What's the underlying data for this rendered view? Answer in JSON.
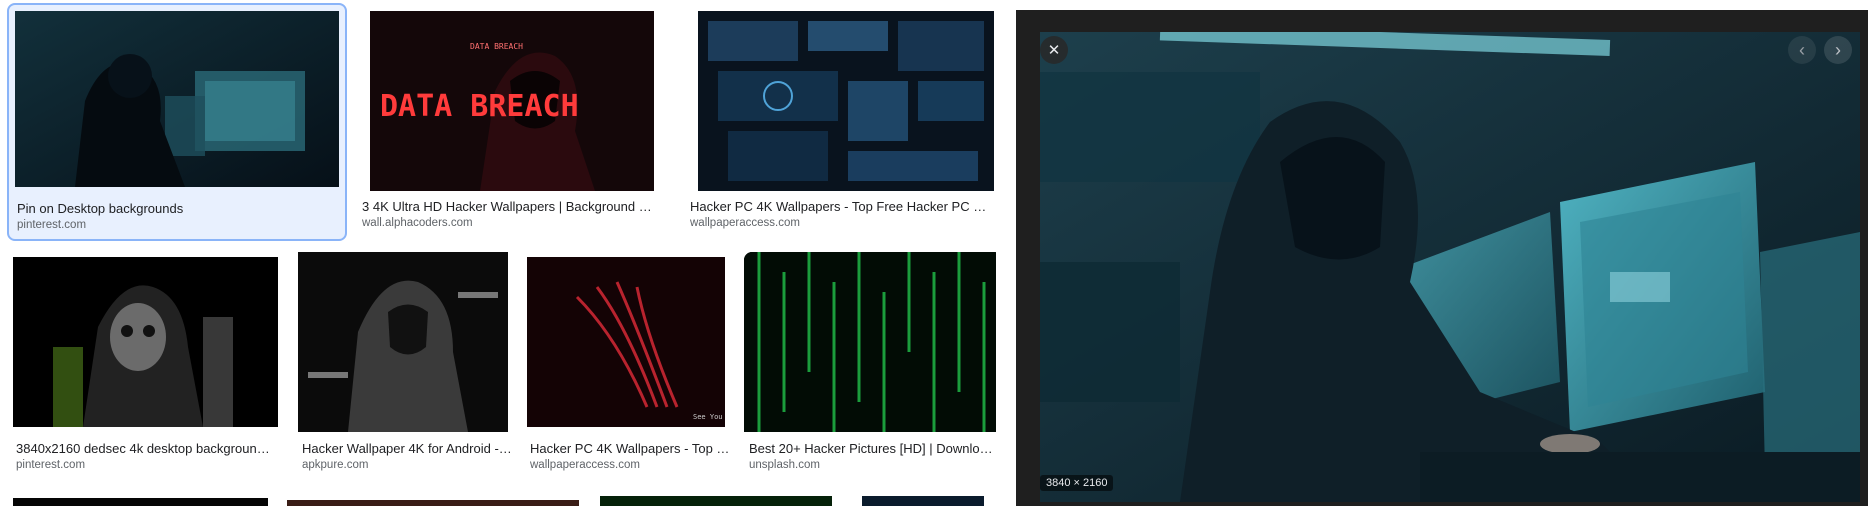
{
  "results": [
    {
      "title": "Pin on Desktop backgrounds",
      "source": "pinterest.com"
    },
    {
      "title": "3 4K Ultra HD Hacker Wallpapers | Background Imag...",
      "source": "wall.alphacoders.com"
    },
    {
      "title": "Hacker PC 4K Wallpapers - Top Free Hacker PC 4K B...",
      "source": "wallpaperaccess.com"
    },
    {
      "title": "3840x2160 dedsec 4k desktop background ...",
      "source": "pinterest.com"
    },
    {
      "title": "Hacker Wallpaper 4K for Android - ...",
      "source": "apkpure.com"
    },
    {
      "title": "Hacker PC 4K Wallpapers - Top F...",
      "source": "wallpaperaccess.com"
    },
    {
      "title": "Best 20+ Hacker Pictures [HD] | Download ...",
      "source": "unsplash.com"
    }
  ],
  "thumb_text": {
    "data_breach_big": "DATA BREACH",
    "data_breach_small": "DATA BREACH",
    "corner_text": "See You"
  },
  "viewer": {
    "dimensions": "3840 × 2160",
    "close_glyph": "✕",
    "prev_glyph": "‹",
    "next_glyph": "›"
  }
}
